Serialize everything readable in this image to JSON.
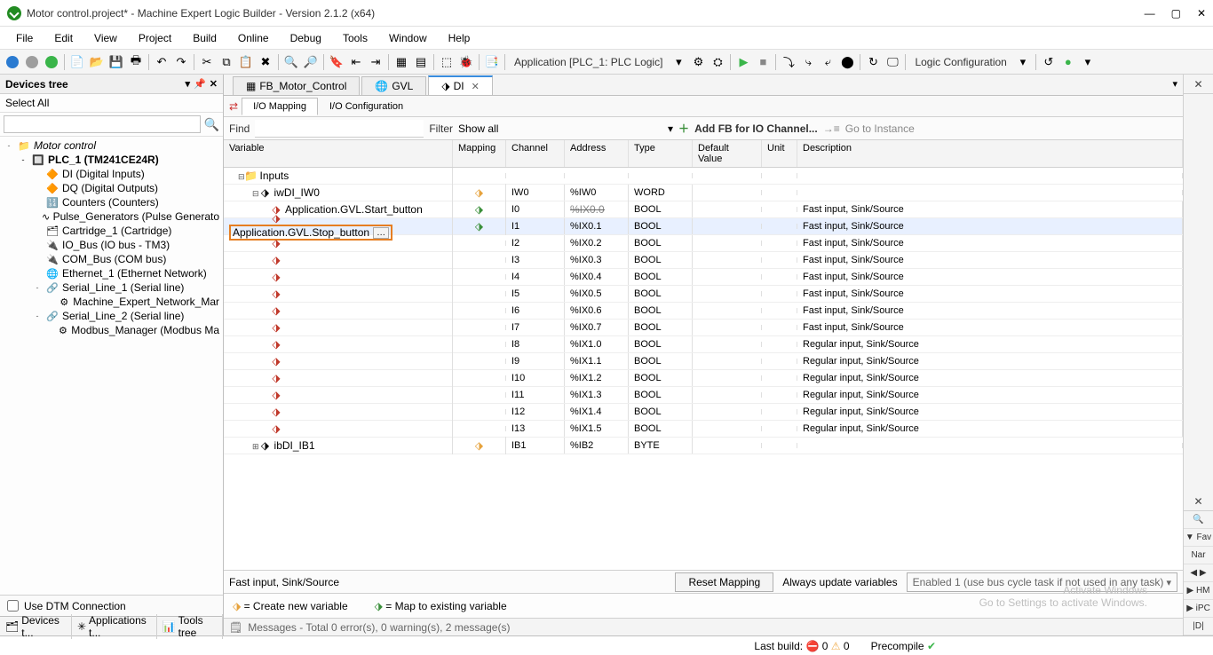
{
  "title": "Motor control.project* - Machine Expert Logic Builder - Version 2.1.2 (x64)",
  "menu": [
    "File",
    "Edit",
    "View",
    "Project",
    "Build",
    "Online",
    "Debug",
    "Tools",
    "Window",
    "Help"
  ],
  "toolbar": {
    "app_combo": "Application [PLC_1: PLC Logic]",
    "logic_combo": "Logic Configuration"
  },
  "left_panel": {
    "title": "Devices tree",
    "select_all": "Select All",
    "tree": [
      {
        "ind": 0,
        "toggle": "-",
        "bold": false,
        "italic": true,
        "icon": "project",
        "label": "Motor control"
      },
      {
        "ind": 1,
        "toggle": "-",
        "bold": true,
        "icon": "plc",
        "label": "PLC_1 (TM241CE24R)"
      },
      {
        "ind": 2,
        "icon": "di",
        "label": "DI (Digital Inputs)"
      },
      {
        "ind": 2,
        "icon": "dq",
        "label": "DQ (Digital Outputs)"
      },
      {
        "ind": 2,
        "icon": "cnt",
        "label": "Counters (Counters)"
      },
      {
        "ind": 2,
        "icon": "pg",
        "label": "Pulse_Generators (Pulse Generato"
      },
      {
        "ind": 2,
        "icon": "cart",
        "label": "Cartridge_1 (Cartridge)"
      },
      {
        "ind": 2,
        "icon": "bus",
        "label": "IO_Bus (IO bus - TM3)"
      },
      {
        "ind": 2,
        "icon": "com",
        "label": "COM_Bus (COM bus)"
      },
      {
        "ind": 2,
        "icon": "eth",
        "label": "Ethernet_1 (Ethernet Network)"
      },
      {
        "ind": 2,
        "toggle": "-",
        "icon": "ser",
        "label": "Serial_Line_1 (Serial line)"
      },
      {
        "ind": 3,
        "icon": "dev",
        "label": "Machine_Expert_Network_Mar"
      },
      {
        "ind": 2,
        "toggle": "-",
        "icon": "ser",
        "label": "Serial_Line_2 (Serial line)"
      },
      {
        "ind": 3,
        "icon": "dev",
        "label": "Modbus_Manager (Modbus Ma"
      }
    ],
    "tabs": [
      "Devices t...",
      "Applications t...",
      "Tools tree"
    ],
    "use_dtm": "Use DTM Connection"
  },
  "tabs": [
    {
      "icon": "fb",
      "label": "FB_Motor_Control",
      "active": false
    },
    {
      "icon": "gvl",
      "label": "GVL",
      "active": false
    },
    {
      "icon": "di",
      "label": "DI",
      "active": true
    }
  ],
  "subtabs": {
    "mapping": "I/O Mapping",
    "config": "I/O Configuration"
  },
  "findbar": {
    "find": "Find",
    "filter": "Filter",
    "show_all": "Show all",
    "addfb": "Add FB for IO Channel...",
    "goto": "Go to Instance"
  },
  "grid": {
    "headers": {
      "var": "Variable",
      "map": "Mapping",
      "ch": "Channel",
      "addr": "Address",
      "type": "Type",
      "def": "Default Value",
      "unit": "Unit",
      "desc": "Description"
    },
    "rows": [
      {
        "kind": "group",
        "ind": 0,
        "toggle": "-",
        "icon": "folder",
        "var": "Inputs"
      },
      {
        "kind": "group",
        "ind": 1,
        "toggle": "-",
        "icon": "var-root",
        "var": "iwDI_IW0",
        "map": "map-new",
        "ch": "IW0",
        "addr": "%IW0",
        "type": "WORD"
      },
      {
        "kind": "leaf",
        "ind": 2,
        "icon": "var-map",
        "var": "Application.GVL.Start_button",
        "map": "map-ex",
        "ch": "I0",
        "addr": "%IX0.0",
        "addr_strike": true,
        "type": "BOOL",
        "desc": "Fast input, Sink/Source"
      },
      {
        "kind": "leaf",
        "ind": 2,
        "icon": "var-map",
        "var": "Application.GVL.Stop_button",
        "highlight": true,
        "ellipsis": true,
        "map": "map-ex",
        "ch": "I1",
        "addr": "%IX0.1",
        "type": "BOOL",
        "desc": "Fast input, Sink/Source"
      },
      {
        "kind": "leaf",
        "ind": 2,
        "icon": "var-map",
        "ch": "I2",
        "addr": "%IX0.2",
        "type": "BOOL",
        "desc": "Fast input, Sink/Source"
      },
      {
        "kind": "leaf",
        "ind": 2,
        "icon": "var-map",
        "ch": "I3",
        "addr": "%IX0.3",
        "type": "BOOL",
        "desc": "Fast input, Sink/Source"
      },
      {
        "kind": "leaf",
        "ind": 2,
        "icon": "var-map",
        "ch": "I4",
        "addr": "%IX0.4",
        "type": "BOOL",
        "desc": "Fast input, Sink/Source"
      },
      {
        "kind": "leaf",
        "ind": 2,
        "icon": "var-map",
        "ch": "I5",
        "addr": "%IX0.5",
        "type": "BOOL",
        "desc": "Fast input, Sink/Source"
      },
      {
        "kind": "leaf",
        "ind": 2,
        "icon": "var-map",
        "ch": "I6",
        "addr": "%IX0.6",
        "type": "BOOL",
        "desc": "Fast input, Sink/Source"
      },
      {
        "kind": "leaf",
        "ind": 2,
        "icon": "var-map",
        "ch": "I7",
        "addr": "%IX0.7",
        "type": "BOOL",
        "desc": "Fast input, Sink/Source"
      },
      {
        "kind": "leaf",
        "ind": 2,
        "icon": "var-map",
        "ch": "I8",
        "addr": "%IX1.0",
        "type": "BOOL",
        "desc": "Regular input, Sink/Source"
      },
      {
        "kind": "leaf",
        "ind": 2,
        "icon": "var-map",
        "ch": "I9",
        "addr": "%IX1.1",
        "type": "BOOL",
        "desc": "Regular input, Sink/Source"
      },
      {
        "kind": "leaf",
        "ind": 2,
        "icon": "var-map",
        "ch": "I10",
        "addr": "%IX1.2",
        "type": "BOOL",
        "desc": "Regular input, Sink/Source"
      },
      {
        "kind": "leaf",
        "ind": 2,
        "icon": "var-map",
        "ch": "I11",
        "addr": "%IX1.3",
        "type": "BOOL",
        "desc": "Regular input, Sink/Source"
      },
      {
        "kind": "leaf",
        "ind": 2,
        "icon": "var-map",
        "ch": "I12",
        "addr": "%IX1.4",
        "type": "BOOL",
        "desc": "Regular input, Sink/Source"
      },
      {
        "kind": "leaf",
        "ind": 2,
        "icon": "var-map",
        "ch": "I13",
        "addr": "%IX1.5",
        "type": "BOOL",
        "desc": "Regular input, Sink/Source"
      },
      {
        "kind": "group",
        "ind": 1,
        "toggle": "+",
        "icon": "var-root",
        "var": "ibDI_IB1",
        "map": "map-new",
        "ch": "IB1",
        "addr": "%IB2",
        "type": "BYTE"
      }
    ]
  },
  "bottom": {
    "leftinfo": "Fast input, Sink/Source",
    "reset": "Reset Mapping",
    "always": "Always update variables",
    "mode": "Enabled 1 (use bus cycle task if not used in any task)"
  },
  "legend": {
    "create": "= Create new variable",
    "map": "= Map to existing variable"
  },
  "right_strip": [
    "▼ Fav",
    "Nar",
    "◀ ▶",
    "▶ HM",
    "▶ iPC",
    "|D|"
  ],
  "messages": "Messages - Total 0 error(s), 0 warning(s), 2 message(s)",
  "statusbar": {
    "lastbuild": "Last build:",
    "err": "0",
    "warn": "0",
    "precompile": "Precompile"
  },
  "watermark": {
    "main": "Activate Windows",
    "sub": "Go to Settings to activate Windows."
  }
}
